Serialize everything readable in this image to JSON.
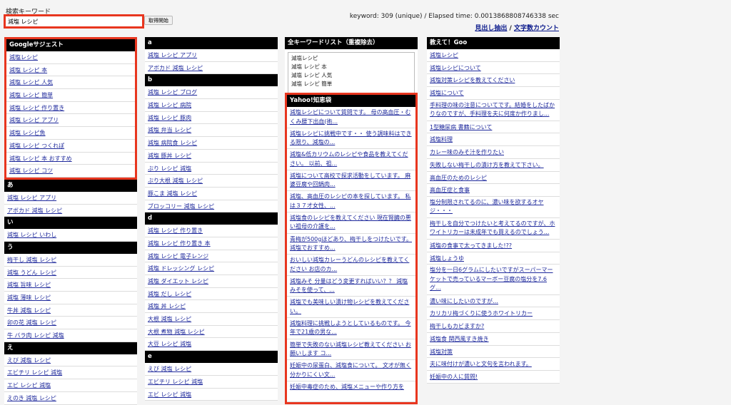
{
  "search": {
    "label": "検索キーワード",
    "value": "減塩 レシピ",
    "button": "取得開始"
  },
  "stats": {
    "text": "keyword: 309 (unique) / Elapsed time: 0.0013868808746338 sec",
    "link1": "見出し抽出",
    "separator": " / ",
    "link2": "文字数カウント"
  },
  "google": {
    "header": "Googleサジェスト",
    "items": [
      "減塩レシピ",
      "減塩 レシピ 本",
      "減塩 レシピ 人気",
      "減塩 レシピ 簡単",
      "減塩 レシピ 作り置き",
      "減塩 レシピ アプリ",
      "減塩 レシピ魚",
      "減塩 レシピ つくれぽ",
      "減塩 レシピ 本 おすすめ",
      "減塩 レシピ コツ"
    ]
  },
  "col1_groups": [
    {
      "header": "あ",
      "items": [
        "減塩 レシピ アプリ",
        "アボカド 減塩 レシピ"
      ]
    },
    {
      "header": "い",
      "items": [
        "減塩 レシピ いわし"
      ]
    },
    {
      "header": "う",
      "items": [
        "梅干し 減塩 レシピ",
        "減塩 うどん レシピ",
        "減塩 旨味 レシピ",
        "減塩 薄味 レシピ",
        "牛丼 減塩 レシピ",
        "卯の花 減塩 レシピ",
        "牛 バラ肉 レシピ 減塩"
      ]
    },
    {
      "header": "え",
      "items": [
        "えび 減塩 レシピ",
        "エビチリ レシピ 減塩",
        "エビ レシピ 減塩",
        "えのき 減塩 レシピ"
      ]
    }
  ],
  "col2_groups": [
    {
      "header": "a",
      "items": [
        "減塩 レシピ アプリ",
        "アボカド 減塩 レシピ"
      ]
    },
    {
      "header": "b",
      "items": [
        "減塩 レシピ ブログ",
        "減塩 レシピ 病院",
        "減塩 レシピ 豚肉",
        "減塩 弁当 レシピ",
        "減塩 病院食 レシピ",
        "減塩 豚丼 レシピ",
        "ぶり レシピ 減塩",
        "ぶり大根 減塩 レシピ",
        "豚こま 減塩 レシピ",
        "ブロッコリー 減塩 レシピ"
      ]
    },
    {
      "header": "d",
      "items": [
        "減塩 レシピ 作り置き",
        "減塩 レシピ 作り置き 本",
        "減塩 レシピ 電子レンジ",
        "減塩 ドレッシング レシピ",
        "減塩 ダイエット レシピ",
        "減塩 だし レシピ",
        "減塩 丼 レシピ",
        "大根 減塩 レシピ",
        "大根 煮物 減塩 レシピ",
        "大豆 レシピ 減塩"
      ]
    },
    {
      "header": "e",
      "items": [
        "えび 減塩 レシピ",
        "エビチリ レシピ 減塩",
        "エビ レシピ 減塩"
      ]
    }
  ],
  "keywords": {
    "header": "全キーワードリスト（重複除去）",
    "lines": [
      "減塩レシピ",
      "減塩 レシピ 本",
      "減塩 レシピ 人気",
      "減塩 レシピ 簡単"
    ]
  },
  "yahoo": {
    "header": "Yahoo!知恵袋",
    "items": [
      "減塩レシピについて質問です。 母の高血圧・むくみ腰下出血(術...",
      "減塩レシピに挑戦中です・・ 使う調味料はできる限り、減塩の...",
      "減塩&低カリウムのレシピや食品を教えてください。 以前、祖...",
      "減塩について高校で探求活動をしています。 麻婆豆腐や回鍋肉...",
      "減塩、高血圧のレシピの本を探しています。 私は３７才女性、...",
      "減塩食のレシピを教えてください 現在腎臓の悪い祖母の介護を...",
      "青梅が500gほどあり、梅干しをつけたいです。 減塩でおすすめ...",
      "おいしい減塩カレーうどんのレシピを教えてください お店のカ...",
      "減塩みそ 分量はどう変更すればいい？？ 減塩みそを使って、...",
      "減塩でも美味しい漬け物レシピを教えてください。",
      "減塩料理に挑戦しようとしているものです。 今年で21歳の男な...",
      "簡単で失敗のない減塩レシピ教えてください お願いします コ...",
      "妊娠中の尿蛋白、減塩食について。 文才が無く分かりにくい文...",
      "妊娠中毒症のため、減塩メニューや作り方を"
    ]
  },
  "goo": {
    "header": "教えて！Goo",
    "items": [
      "減塩レシピ",
      "減塩レシピについて",
      "減塩対策レシピを教えてください",
      "減塩について",
      "手料理の味の注意についてです。結婚をしたばかりなのですが、手料理を夫に何度か作りまし...",
      "1型糖尿病 書籍について",
      "減塩料理",
      "カレー味のみそ汁を作りたい",
      "失敗しない梅干しの漬け方を教えて下さい。",
      "高血圧のためのレシピ",
      "高血圧症と食事",
      "塩分制限されてるのに、濃い味を欲するオヤジ・・・",
      "梅干しを自分でつけたいと考えてるのですが、ホワイトリカーは未成年でも買えるのでしょう...",
      "減塩の食事で太ってきました!??",
      "減塩しょうゆ",
      "塩分を一日6グラムにしたいですがスーパーマーケットで売っているマーボー豆腐の塩分を7.6グ...",
      "濃い味にしたいのですが…",
      "カリカリ梅づくりに使うホワイトリカー",
      "梅干しもカビますか?",
      "減塩食 関西風すき焼き",
      "減塩対策",
      "夫に味付けが濃いと文句を言われます。",
      "妊娠中の人に質問!"
    ]
  }
}
